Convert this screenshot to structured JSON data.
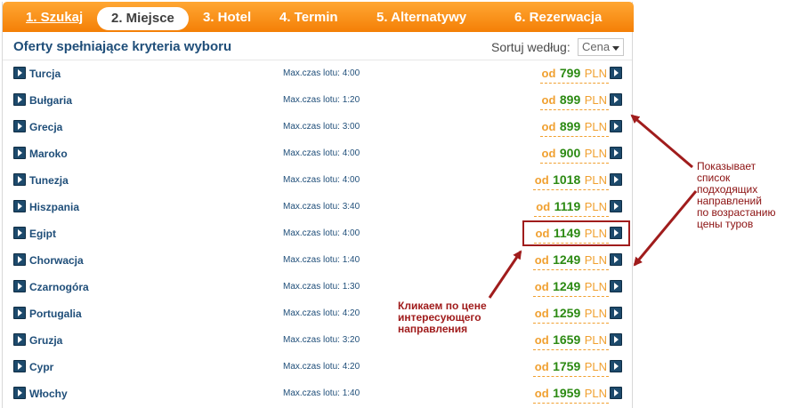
{
  "steps": [
    {
      "label": "1. Szukaj"
    },
    {
      "label": "2. Miejsce"
    },
    {
      "label": "3. Hotel"
    },
    {
      "label": "4. Termin"
    },
    {
      "label": "5. Alternatywy"
    },
    {
      "label": "6. Rezerwacja"
    }
  ],
  "header": {
    "title": "Oferty spełniające kryteria wyboru",
    "sort_label": "Sortuj według:",
    "sort_value": "Cena"
  },
  "offers": [
    {
      "country": "Turcja",
      "flight": "Max.czas lotu: 4:00",
      "od": "od",
      "price": "799",
      "currency": "PLN"
    },
    {
      "country": "Bułgaria",
      "flight": "Max.czas lotu: 1:20",
      "od": "od",
      "price": "899",
      "currency": "PLN"
    },
    {
      "country": "Grecja",
      "flight": "Max.czas lotu: 3:00",
      "od": "od",
      "price": "899",
      "currency": "PLN"
    },
    {
      "country": "Maroko",
      "flight": "Max.czas lotu: 4:00",
      "od": "od",
      "price": "900",
      "currency": "PLN"
    },
    {
      "country": "Tunezja",
      "flight": "Max.czas lotu: 4:00",
      "od": "od",
      "price": "1018",
      "currency": "PLN"
    },
    {
      "country": "Hiszpania",
      "flight": "Max.czas lotu: 3:40",
      "od": "od",
      "price": "1119",
      "currency": "PLN"
    },
    {
      "country": "Egipt",
      "flight": "Max.czas lotu: 4:00",
      "od": "od",
      "price": "1149",
      "currency": "PLN"
    },
    {
      "country": "Chorwacja",
      "flight": "Max.czas lotu: 1:40",
      "od": "od",
      "price": "1249",
      "currency": "PLN"
    },
    {
      "country": "Czarnogóra",
      "flight": "Max.czas lotu: 1:30",
      "od": "od",
      "price": "1249",
      "currency": "PLN"
    },
    {
      "country": "Portugalia",
      "flight": "Max.czas lotu: 4:20",
      "od": "od",
      "price": "1259",
      "currency": "PLN"
    },
    {
      "country": "Gruzja",
      "flight": "Max.czas lotu: 3:20",
      "od": "od",
      "price": "1659",
      "currency": "PLN"
    },
    {
      "country": "Cypr",
      "flight": "Max.czas lotu: 4:20",
      "od": "od",
      "price": "1759",
      "currency": "PLN"
    },
    {
      "country": "Włochy",
      "flight": "Max.czas lotu: 1:40",
      "od": "od",
      "price": "1959",
      "currency": "PLN"
    }
  ],
  "annotations": {
    "left_note": [
      "Кликаем по цене",
      "интересующего",
      "направления"
    ],
    "right_note": [
      "Показывает",
      "список",
      "подходящих",
      "направлений",
      "по возрастанию",
      "цены туров"
    ]
  },
  "colors": {
    "accent_orange": "#f47f06",
    "price_green": "#2c8a13",
    "link_blue": "#1f4e79",
    "annotation_red": "#a01c1c"
  }
}
